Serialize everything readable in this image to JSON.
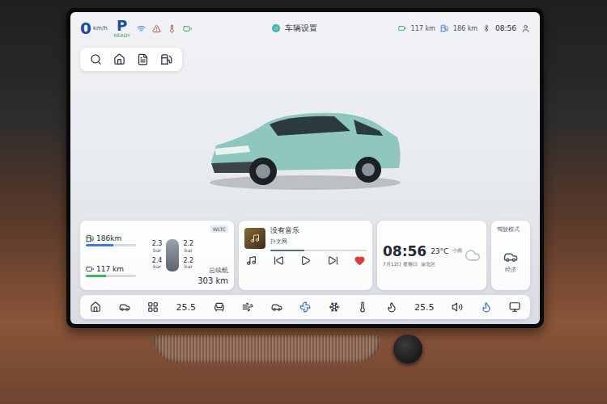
{
  "status_bar": {
    "speed": "0",
    "speed_unit": "km/h",
    "gear": "P",
    "ready": "READY",
    "title": "车辆设置",
    "range_electric": "117 km",
    "range_fuel": "186 km",
    "time": "08:56"
  },
  "range_card": {
    "fuel_range": "186km",
    "electric_range": "117 km",
    "fuel_level": 0.55,
    "battery_level": 0.4,
    "tires": [
      "2.3",
      "2.2",
      "2.4",
      "2.2"
    ],
    "tire_unit": "bar",
    "cycle": "WLTC",
    "total_label": "总续航",
    "total": "303 km"
  },
  "media_card": {
    "title": "没有音乐",
    "subtitle": "扑文网",
    "progress": 0.35,
    "liked": true
  },
  "weather_card": {
    "time": "08:56",
    "temp": "23°C",
    "condition": "小雨",
    "date": "7月12日 星期日",
    "location": "渝北区"
  },
  "drive_mode_card": {
    "title": "驾驶模式",
    "mode": "经济"
  },
  "dock": [
    {
      "kind": "button",
      "active": false
    },
    {
      "kind": "button",
      "active": false
    },
    {
      "kind": "button",
      "active": false
    },
    {
      "kind": "temperature",
      "text": "25.5"
    },
    {
      "kind": "button",
      "active": false
    },
    {
      "kind": "button",
      "active": false
    },
    {
      "kind": "button",
      "active": false
    },
    {
      "kind": "button",
      "active": true
    },
    {
      "kind": "button",
      "active": false
    },
    {
      "kind": "button",
      "active": false
    },
    {
      "kind": "button",
      "active": false
    },
    {
      "kind": "temperature",
      "text": "25.5"
    },
    {
      "kind": "button",
      "active": false
    },
    {
      "kind": "button",
      "active": true
    },
    {
      "kind": "button",
      "active": false
    }
  ]
}
